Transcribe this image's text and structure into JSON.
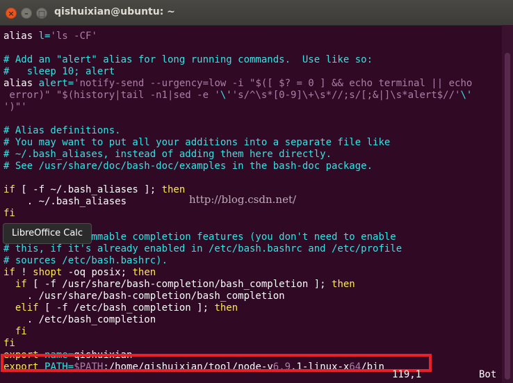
{
  "window": {
    "title": "qishuixian@ubuntu: ~",
    "close_glyph": "×",
    "minimize_glyph": "–",
    "maximize_glyph": "□"
  },
  "terminal_lines": [
    [
      [
        "w",
        "alias "
      ],
      [
        "c",
        "l="
      ],
      [
        "m",
        "'ls -CF'"
      ]
    ],
    [],
    [
      [
        "c",
        "# Add an \"alert\" alias for long running commands.  Use like so:"
      ]
    ],
    [
      [
        "c",
        "#   sleep 10; alert"
      ]
    ],
    [
      [
        "w",
        "alias "
      ],
      [
        "c",
        "alert="
      ],
      [
        "m",
        "'notify-send --urgency=low -i \"$([ $? = 0 ] && echo terminal || echo"
      ]
    ],
    [
      [
        "m",
        " error)\" \"$(history|tail -n1|sed -e '"
      ],
      [
        "c",
        "\\'"
      ],
      [
        "m",
        "'s/^\\s*[0-9]\\+\\s*//;s/[;&|]\\s*alert$//'"
      ],
      [
        "c",
        "\\'"
      ]
    ],
    [
      [
        "m",
        "')\"'"
      ]
    ],
    [],
    [
      [
        "c",
        "# Alias definitions."
      ]
    ],
    [
      [
        "c",
        "# You may want to put all your additions into a separate file like"
      ]
    ],
    [
      [
        "c",
        "# ~/.bash_aliases, instead of adding them here directly."
      ]
    ],
    [
      [
        "c",
        "# See /usr/share/doc/bash-doc/examples in the bash-doc package."
      ]
    ],
    [],
    [
      [
        "y",
        "if"
      ],
      [
        "w",
        " [ -f ~/.bash_aliases ]; "
      ],
      [
        "y",
        "then"
      ]
    ],
    [
      [
        "w",
        "    . ~/.bash_aliases"
      ]
    ],
    [
      [
        "y",
        "fi"
      ]
    ],
    [],
    [
      [
        "c",
        "# enable programmable completion features (you don't need to enable"
      ]
    ],
    [
      [
        "c",
        "# this, if it's already enabled in /etc/bash.bashrc and /etc/profile"
      ]
    ],
    [
      [
        "c",
        "# sources /etc/bash.bashrc)."
      ]
    ],
    [
      [
        "y",
        "if"
      ],
      [
        "w",
        " ! "
      ],
      [
        "y",
        "shopt"
      ],
      [
        "w",
        " -oq posix; "
      ],
      [
        "y",
        "then"
      ]
    ],
    [
      [
        "w",
        "  "
      ],
      [
        "y",
        "if"
      ],
      [
        "w",
        " [ -f /usr/share/bash-completion/bash_completion ]; "
      ],
      [
        "y",
        "then"
      ]
    ],
    [
      [
        "w",
        "    . /usr/share/bash-completion/bash_completion"
      ]
    ],
    [
      [
        "w",
        "  "
      ],
      [
        "y",
        "elif"
      ],
      [
        "w",
        " [ -f /etc/bash_completion ]; "
      ],
      [
        "y",
        "then"
      ]
    ],
    [
      [
        "w",
        "    . /etc/bash_completion"
      ]
    ],
    [
      [
        "w",
        "  "
      ],
      [
        "y",
        "fi"
      ]
    ],
    [
      [
        "y",
        "fi"
      ]
    ],
    [
      [
        "y",
        "export"
      ],
      [
        "w",
        " "
      ],
      [
        "c",
        "name="
      ],
      [
        "w",
        "qishuixian"
      ]
    ],
    [
      [
        "y",
        "export"
      ],
      [
        "w",
        " "
      ],
      [
        "c",
        "PATH="
      ],
      [
        "m",
        "$PATH"
      ],
      [
        "w",
        ":/home/qishuixian/tool/node-v"
      ],
      [
        "m",
        "6.9"
      ],
      [
        "w",
        ".1-linux-x"
      ],
      [
        "m",
        "64"
      ],
      [
        "w",
        "/bin"
      ]
    ]
  ],
  "status": {
    "position": "119,1",
    "scroll": "Bot"
  },
  "watermark": "http://blog.csdn.net/",
  "tooltip": "LibreOffice Calc",
  "colors": {
    "background": "#300a24",
    "comment": "#34e2e2",
    "keyword": "#fce94f",
    "string": "#ad7fa8",
    "highlight_box": "#e8202a"
  }
}
